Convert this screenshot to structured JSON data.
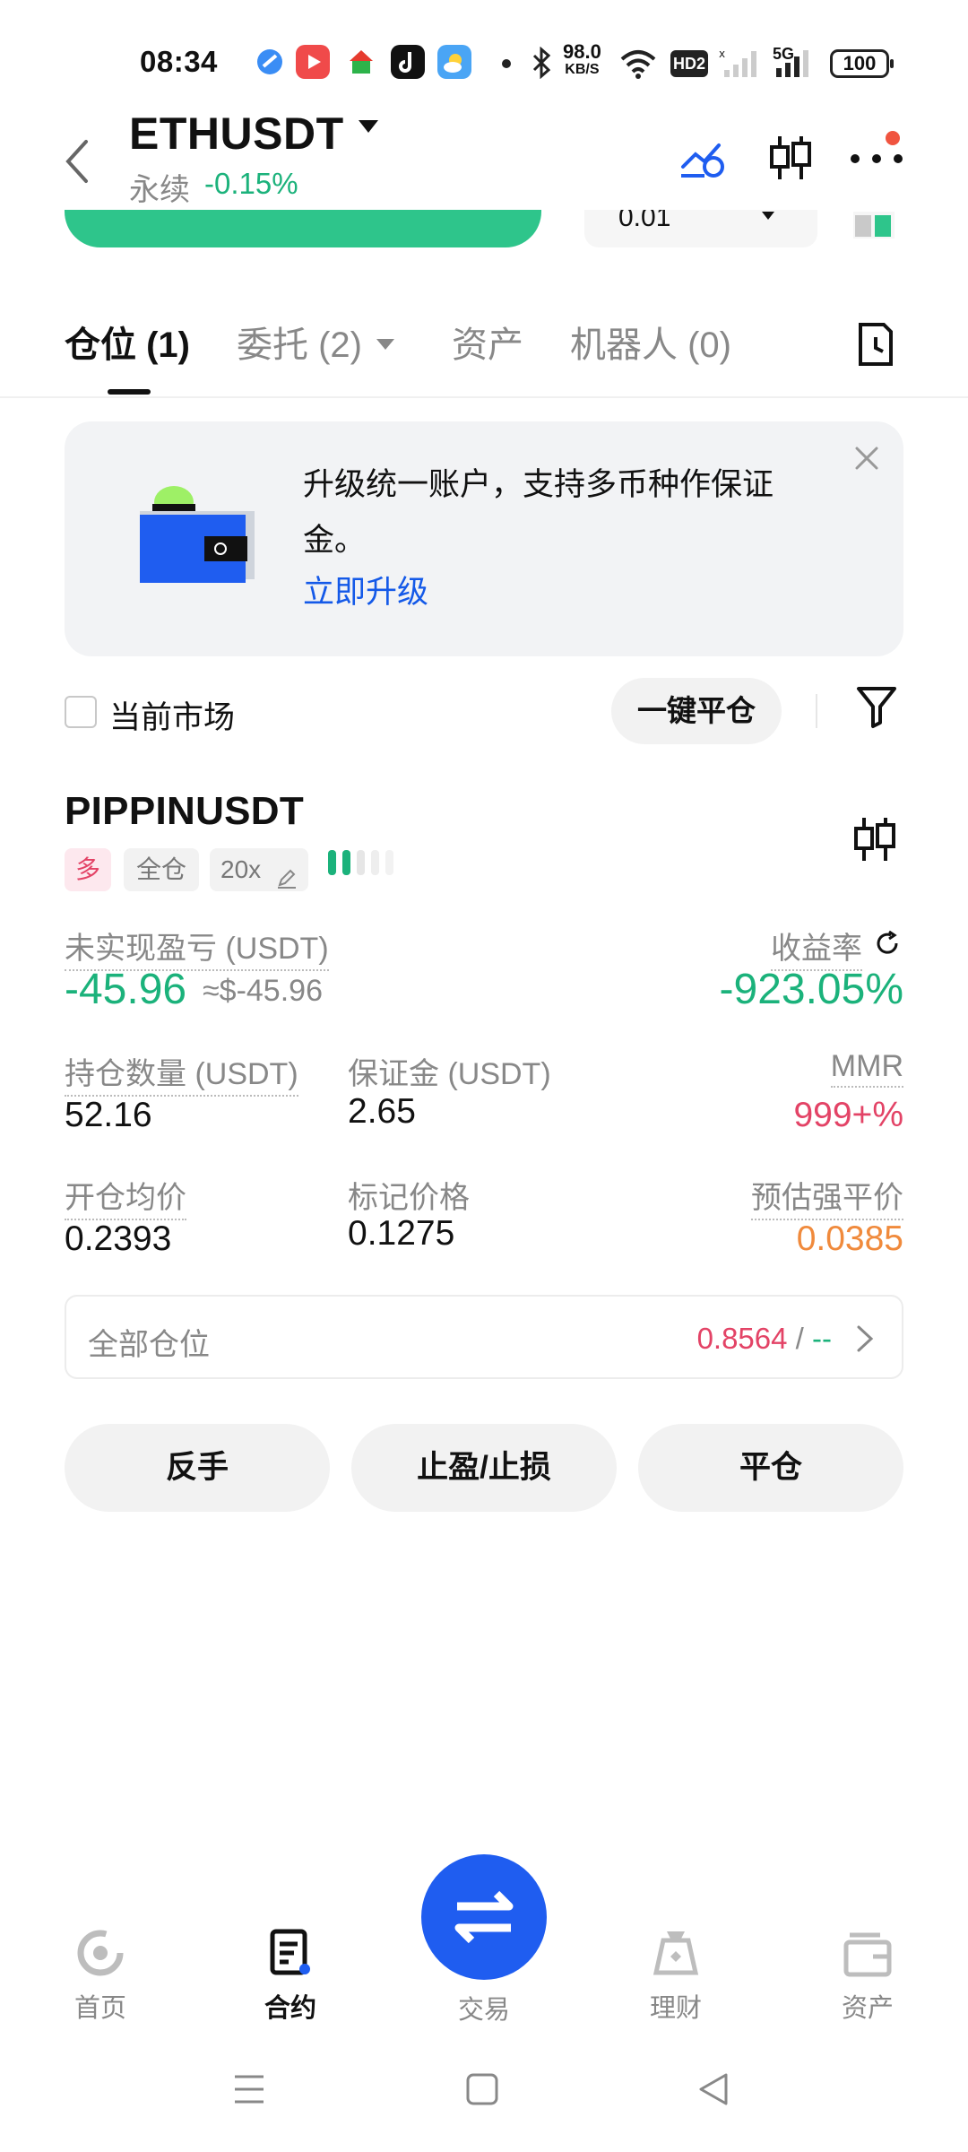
{
  "status_bar": {
    "time": "08:34",
    "net_speed_top": "98.0",
    "net_speed_unit": "KB/S",
    "hd": "HD2",
    "fiveg": "5G",
    "battery": "100"
  },
  "header": {
    "pair": "ETHUSDT",
    "type": "永续",
    "change": "-0.15%"
  },
  "order_form_partial": {
    "qty": "0.01"
  },
  "tabs": [
    {
      "label": "仓位 (1)"
    },
    {
      "label": "委托 (2)"
    },
    {
      "label": "资产"
    },
    {
      "label": "机器人 (0)"
    }
  ],
  "banner": {
    "text": "升级统一账户，支持多币种作保证金。",
    "link": "立即升级"
  },
  "filter": {
    "current_market": "当前市场",
    "close_all": "一键平仓"
  },
  "position": {
    "symbol": "PIPPINUSDT",
    "side": "多",
    "margin_mode": "全仓",
    "leverage": "20x",
    "unrealized_label": "未实现盈亏 (USDT)",
    "unrealized_value": "-45.96",
    "unrealized_approx": "≈$-45.96",
    "roe_label": "收益率",
    "roe_value": "-923.05%",
    "size_label": "持仓数量 (USDT)",
    "size_value": "52.16",
    "margin_label": "保证金 (USDT)",
    "margin_value": "2.65",
    "mmr_label": "MMR",
    "mmr_value": "999+%",
    "entry_label": "开仓均价",
    "entry_value": "0.2393",
    "mark_label": "标记价格",
    "mark_value": "0.1275",
    "liq_label": "预估强平价",
    "liq_value": "0.0385"
  },
  "all_positions": {
    "label": "全部仓位",
    "value_red": "0.8564",
    "sep": " / ",
    "value_green": "--"
  },
  "actions": {
    "reverse": "反手",
    "tpsl": "止盈/止损",
    "close": "平仓"
  },
  "nav": {
    "home": "首页",
    "futures": "合约",
    "trade": "交易",
    "earn": "理财",
    "assets": "资产"
  },
  "colors": {
    "green": "#1bb27b",
    "red": "#e34366",
    "orange": "#f08a3c",
    "blue": "#1f5df0"
  }
}
